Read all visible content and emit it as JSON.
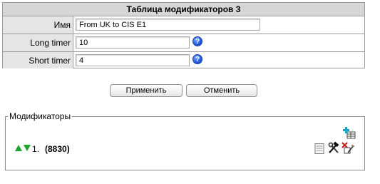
{
  "form": {
    "title": "Таблица модификаторов 3",
    "fields": [
      {
        "label": "Имя",
        "value": "From UK to CIS E1",
        "has_help": false
      },
      {
        "label": "Long timer",
        "value": "10",
        "has_help": true
      },
      {
        "label": "Short timer",
        "value": "4",
        "has_help": true
      }
    ]
  },
  "buttons": {
    "apply_label": "Применить",
    "cancel_label": "Отменить"
  },
  "modifiers": {
    "legend": "Модификаторы",
    "items": [
      {
        "index": "1.",
        "code": "(8830)"
      }
    ]
  },
  "icons": {
    "help": "help-icon",
    "add": "add-modifier-icon",
    "move_up": "arrow-up-icon",
    "move_down": "arrow-down-icon",
    "view": "document-icon",
    "edit": "tools-icon",
    "delete": "delete-icon"
  },
  "colors": {
    "title_bar": "#d6d6d6",
    "label_bg": "#e5e5e5",
    "arrow_green": "#1fa32c",
    "help_blue": "#1c4fd8"
  }
}
